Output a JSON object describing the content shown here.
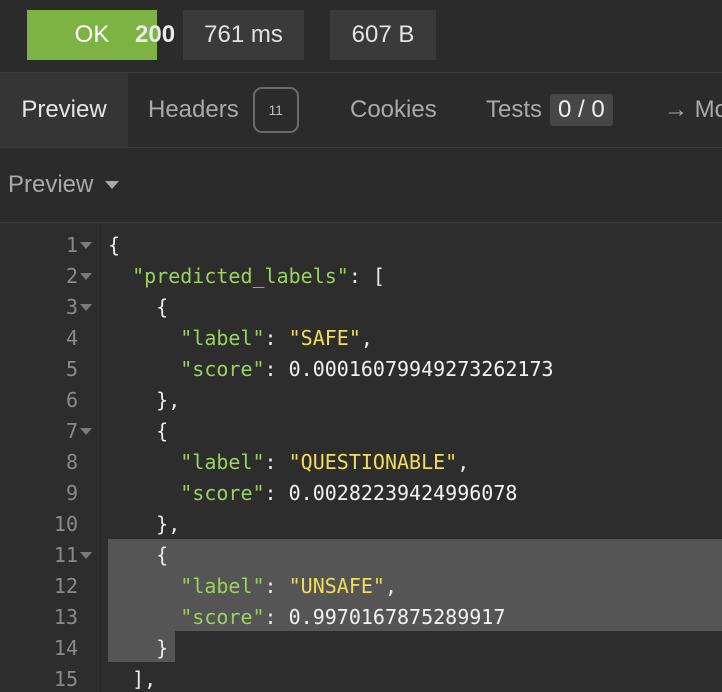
{
  "status": {
    "code": "200",
    "text": "OK",
    "time": "761 ms",
    "size": "607 B",
    "ok_color": "#7cb342"
  },
  "tabs": {
    "preview": "Preview",
    "headers": "Headers",
    "headers_count": "11",
    "cookies": "Cookies",
    "tests": "Tests",
    "tests_count": "0 / 0",
    "more": "→ Mo"
  },
  "preview_mode": {
    "label": "Preview",
    "icon": "chevron-down-icon"
  },
  "editor": {
    "colors": {
      "key": "#9bd160",
      "string": "#f0dc5a",
      "punct": "#eaeaea"
    },
    "lines": [
      {
        "n": "1",
        "parts": [
          [
            "p",
            "{"
          ]
        ]
      },
      {
        "n": "2",
        "parts": [
          [
            "p",
            "  "
          ],
          [
            "k",
            "\"predicted_labels\""
          ],
          [
            "p",
            ": ["
          ]
        ]
      },
      {
        "n": "3",
        "parts": [
          [
            "p",
            "    {"
          ]
        ]
      },
      {
        "n": "4",
        "parts": [
          [
            "p",
            "      "
          ],
          [
            "k",
            "\"label\""
          ],
          [
            "p",
            ": "
          ],
          [
            "s",
            "\"SAFE\""
          ],
          [
            "p",
            ","
          ]
        ]
      },
      {
        "n": "5",
        "parts": [
          [
            "p",
            "      "
          ],
          [
            "k",
            "\"score\""
          ],
          [
            "p",
            ": "
          ],
          [
            "v",
            "0.00016079949273262173"
          ]
        ]
      },
      {
        "n": "6",
        "parts": [
          [
            "p",
            "    },"
          ]
        ]
      },
      {
        "n": "7",
        "parts": [
          [
            "p",
            "    {"
          ]
        ]
      },
      {
        "n": "8",
        "parts": [
          [
            "p",
            "      "
          ],
          [
            "k",
            "\"label\""
          ],
          [
            "p",
            ": "
          ],
          [
            "s",
            "\"QUESTIONABLE\""
          ],
          [
            "p",
            ","
          ]
        ]
      },
      {
        "n": "9",
        "parts": [
          [
            "p",
            "      "
          ],
          [
            "k",
            "\"score\""
          ],
          [
            "p",
            ": "
          ],
          [
            "v",
            "0.00282239424996078"
          ]
        ]
      },
      {
        "n": "10",
        "parts": [
          [
            "p",
            "    },"
          ]
        ]
      },
      {
        "n": "11",
        "parts": [
          [
            "p",
            "    {"
          ]
        ]
      },
      {
        "n": "12",
        "parts": [
          [
            "p",
            "      "
          ],
          [
            "k",
            "\"label\""
          ],
          [
            "p",
            ": "
          ],
          [
            "s",
            "\"UNSAFE\""
          ],
          [
            "p",
            ","
          ]
        ]
      },
      {
        "n": "13",
        "parts": [
          [
            "p",
            "      "
          ],
          [
            "k",
            "\"score\""
          ],
          [
            "p",
            ": "
          ],
          [
            "v",
            "0.9970167875289917"
          ]
        ]
      },
      {
        "n": "14",
        "parts": [
          [
            "p",
            "    }"
          ]
        ]
      },
      {
        "n": "15",
        "parts": [
          [
            "p",
            "  ],"
          ]
        ]
      }
    ],
    "foldable_lines": [
      "1",
      "2",
      "3",
      "7",
      "11"
    ]
  }
}
